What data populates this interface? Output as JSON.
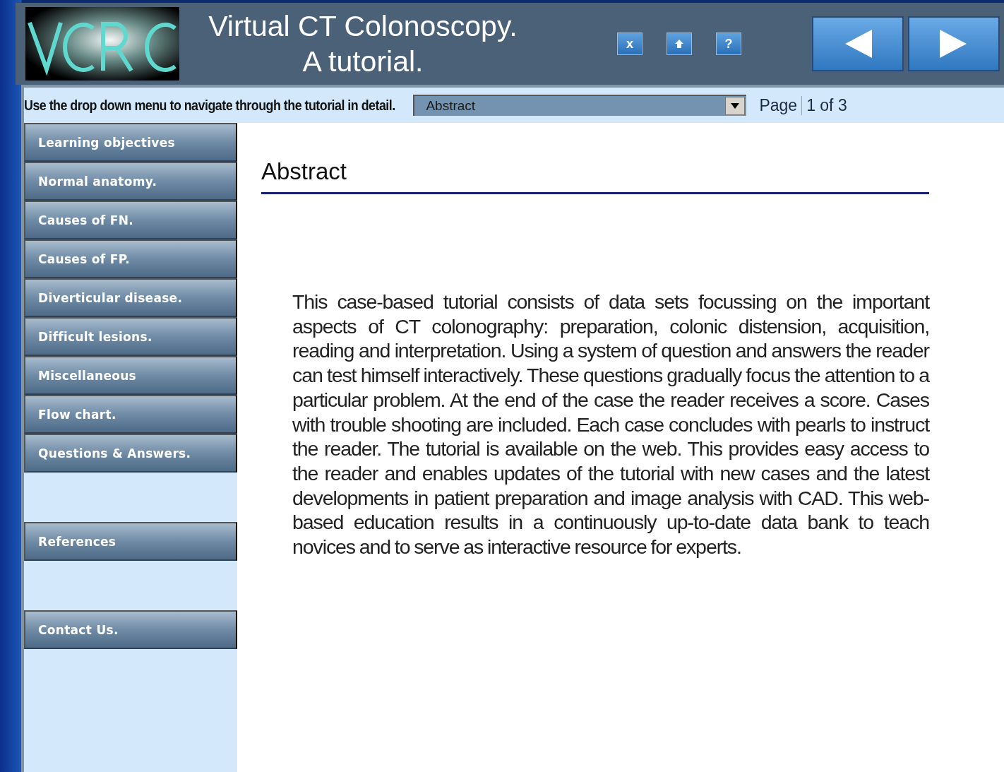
{
  "header": {
    "title_line_1": "Virtual CT Colonoscopy.",
    "title_line_2": "A tutorial.",
    "tool_buttons": [
      {
        "kind": "close",
        "label": "x"
      },
      {
        "kind": "home"
      },
      {
        "kind": "help",
        "label": "?"
      }
    ],
    "nav_buttons": [
      {
        "kind": "back"
      },
      {
        "kind": "forward"
      }
    ]
  },
  "navbar": {
    "instruction": "Use the drop down menu to navigate through the tutorial in detail.",
    "dropdown_value": "Abstract",
    "page_label": "Page",
    "page_value": "1 of 3"
  },
  "sidebar": {
    "groups": [
      {
        "items": [
          {
            "label": "Learning objectives"
          },
          {
            "label": "Normal anatomy."
          },
          {
            "label": "Causes of FN."
          },
          {
            "label": "Causes of FP."
          },
          {
            "label": "Diverticular disease."
          },
          {
            "label": "Difficult lesions."
          },
          {
            "label": "Miscellaneous"
          },
          {
            "label": "Flow chart."
          },
          {
            "label": "Questions & Answers."
          }
        ]
      },
      {
        "items": [
          {
            "label": "References"
          }
        ]
      },
      {
        "items": [
          {
            "label": "Contact Us."
          }
        ]
      }
    ]
  },
  "content": {
    "heading": "Abstract",
    "body": "This case-based tutorial consists of data sets focussing on the important aspects of CT colonography: preparation, colonic distension, acquisition, reading and interpretation. Using a system of question and answers the reader can test himself interactively. These questions gradually focus the attention to a particular problem. At the end of the case the reader receives a score. Cases with trouble shooting are included. Each case concludes with pearls to instruct the reader. The tutorial is available on the web. This provides easy access to the reader and enables updates of the tutorial with new cases and the latest developments in patient preparation and image analysis with CAD. This web-based education results in a continuously up-to-date data bank to teach novices and to serve as interactive resource for experts."
  }
}
